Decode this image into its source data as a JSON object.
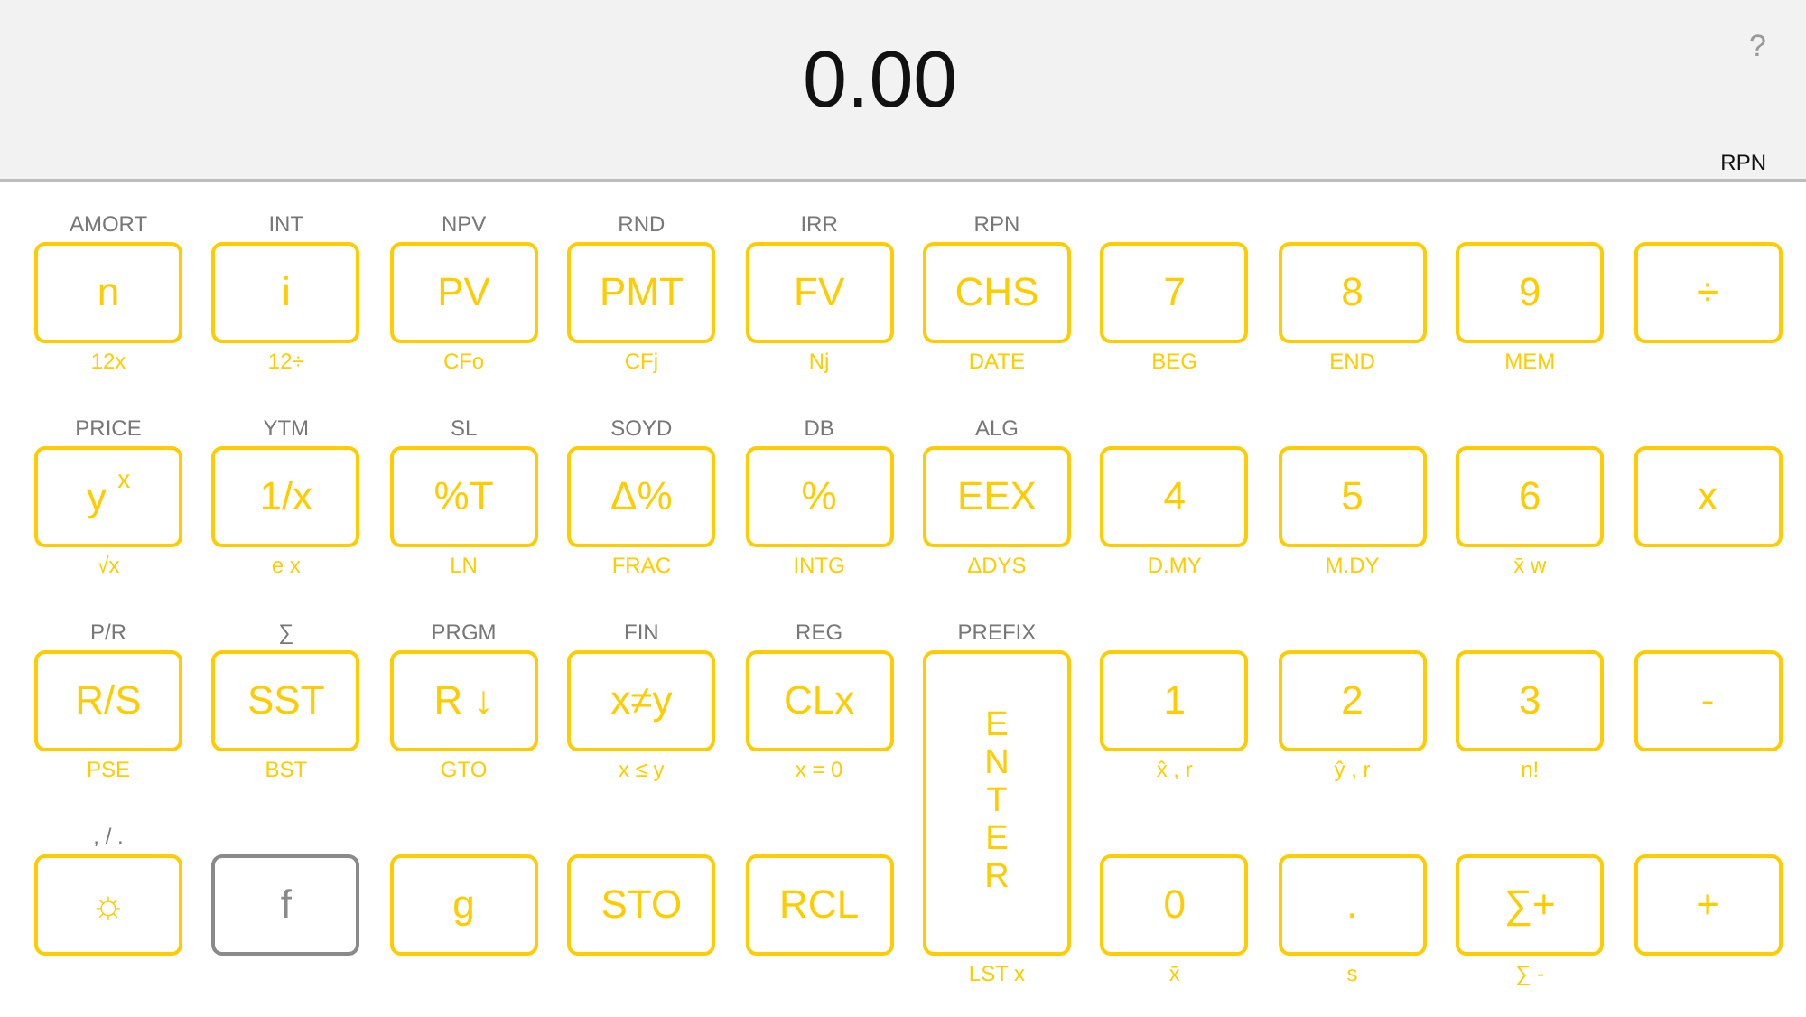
{
  "display": {
    "value": "0.00",
    "help": "?",
    "mode": "RPN"
  },
  "keys": [
    {
      "kind": "key",
      "top": "AMORT",
      "label": "n",
      "bottom": "12x",
      "active": false
    },
    {
      "kind": "key",
      "top": "INT",
      "label": "i",
      "bottom": "12÷",
      "active": false
    },
    {
      "kind": "key",
      "top": "NPV",
      "label": "PV",
      "bottom": "CFo",
      "active": false
    },
    {
      "kind": "key",
      "top": "RND",
      "label": "PMT",
      "bottom": "CFj",
      "active": false
    },
    {
      "kind": "key",
      "top": "IRR",
      "label": "FV",
      "bottom": "Nj",
      "active": false
    },
    {
      "kind": "key",
      "top": "RPN",
      "label": "CHS",
      "bottom": "DATE",
      "active": false
    },
    {
      "kind": "key",
      "label": "7",
      "bottom": "BEG",
      "active": false
    },
    {
      "kind": "key",
      "label": "8",
      "bottom": "END",
      "active": false
    },
    {
      "kind": "key",
      "label": "9",
      "bottom": "MEM",
      "active": false
    },
    {
      "kind": "key",
      "label": "÷",
      "active": false
    },
    {
      "kind": "key",
      "top": "PRICE",
      "label": "y $^{x}$",
      "bottom": "√x",
      "active": false
    },
    {
      "kind": "key",
      "top": "YTM",
      "label": "1/x",
      "bottom": "e x",
      "active": false
    },
    {
      "kind": "key",
      "top": "SL",
      "label": "%T",
      "bottom": "LN",
      "active": false
    },
    {
      "kind": "key",
      "top": "SOYD",
      "label": "Δ%",
      "bottom": "FRAC",
      "active": false
    },
    {
      "kind": "key",
      "top": "DB",
      "label": "%",
      "bottom": "INTG",
      "active": false
    },
    {
      "kind": "key",
      "top": "ALG",
      "label": "EEX",
      "bottom": "ΔDYS",
      "active": false
    },
    {
      "kind": "key",
      "label": "4",
      "bottom": "D.MY",
      "active": false
    },
    {
      "kind": "key",
      "label": "5",
      "bottom": "M.DY",
      "active": false
    },
    {
      "kind": "key",
      "label": "6",
      "bottom": "x̄ w",
      "active": false
    },
    {
      "kind": "key",
      "label": "x",
      "active": false
    },
    {
      "kind": "key",
      "top": "P/R",
      "label": "R/S",
      "bottom": "PSE",
      "active": false
    },
    {
      "kind": "key",
      "top": "∑",
      "label": "SST",
      "bottom": "BST",
      "active": false
    },
    {
      "kind": "key",
      "top": "PRGM",
      "label": "R ↓",
      "bottom": "GTO",
      "active": false
    },
    {
      "kind": "key",
      "top": "FIN",
      "label": "x≠y",
      "bottom": "x ≤ y",
      "active": false
    },
    {
      "kind": "key",
      "top": "REG",
      "label": "CLx",
      "bottom": "x = 0",
      "active": false
    },
    {
      "kind": "enter",
      "top": "PREFIX",
      "label": "ENTER",
      "bottom": "LST x",
      "active": false
    },
    {
      "kind": "key",
      "label": "1",
      "bottom": "x̂ , r",
      "active": false
    },
    {
      "kind": "key",
      "label": "2",
      "bottom": "ŷ , r",
      "active": false
    },
    {
      "kind": "key",
      "label": "3",
      "bottom": "n!",
      "active": false
    },
    {
      "kind": "key",
      "label": "-",
      "active": false
    },
    {
      "kind": "key",
      "top": ", / .",
      "label": "☼",
      "active": false
    },
    {
      "kind": "key",
      "label": "f",
      "active": true
    },
    {
      "kind": "key",
      "label": "g",
      "active": false
    },
    {
      "kind": "key",
      "label": "STO",
      "active": false
    },
    {
      "kind": "key",
      "label": "RCL",
      "active": false
    },
    {
      "kind": "key",
      "label": "0",
      "bottom": "x̄",
      "active": false
    },
    {
      "kind": "key",
      "label": ".",
      "bottom": "s",
      "active": false
    },
    {
      "kind": "key",
      "label": "∑+",
      "bottom": "∑ -",
      "active": false
    },
    {
      "kind": "key",
      "label": "+",
      "active": false
    }
  ]
}
